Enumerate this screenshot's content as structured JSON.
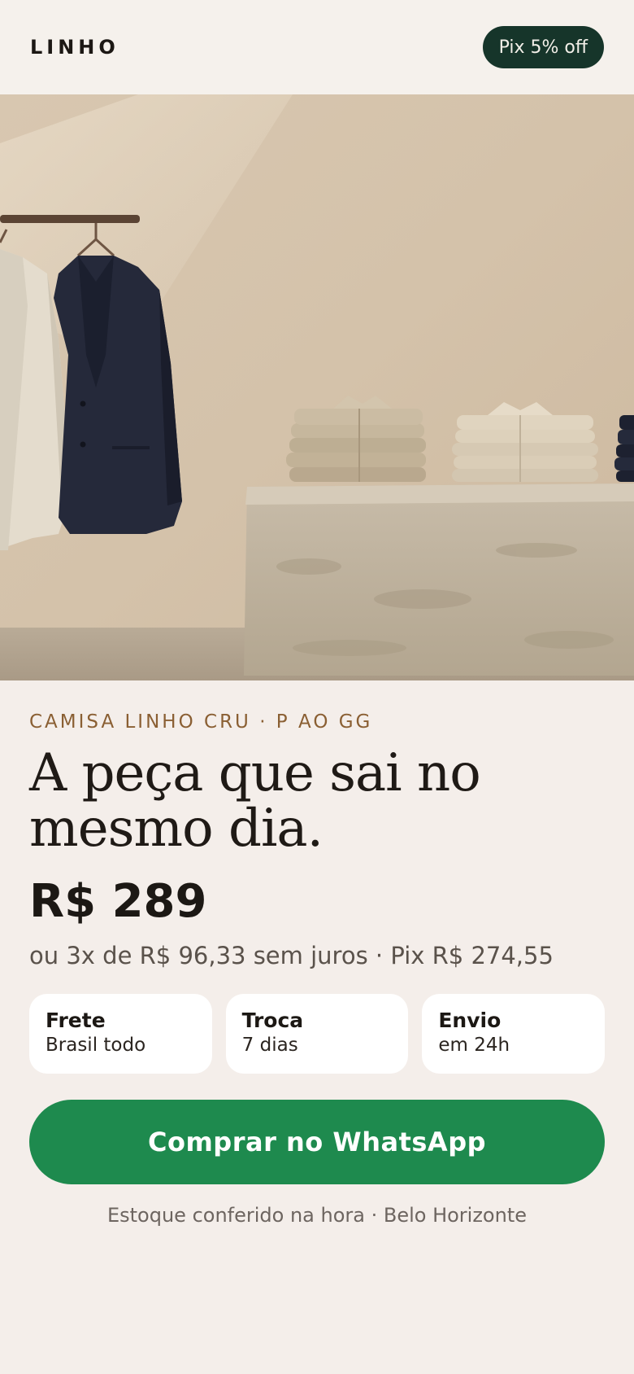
{
  "header": {
    "brand": "LINHO",
    "promo_badge": "Pix 5% off"
  },
  "hero": {
    "image": "product-photo: linen shirts on hanger rail, navy blazer, folded linen shirts on stone plinth"
  },
  "product": {
    "eyebrow": "CAMISA LINHO CRU · P AO GG",
    "headline": "A peça que sai no mesmo dia.",
    "price": "R$ 289",
    "installments": "ou 3x de R$ 96,33 sem juros · Pix R$ 274,55"
  },
  "features": [
    {
      "title": "Frete",
      "subtitle": "Brasil todo"
    },
    {
      "title": "Troca",
      "subtitle": "7 dias"
    },
    {
      "title": "Envio",
      "subtitle": "em 24h"
    }
  ],
  "cta": {
    "label": "Comprar no WhatsApp"
  },
  "footer_note": "Estoque conferido na hora · Belo Horizonte",
  "colors": {
    "background": "#f4eeea",
    "badge": "#16352a",
    "accent_text": "#8a5f33",
    "cta": "#1e8a4e"
  }
}
